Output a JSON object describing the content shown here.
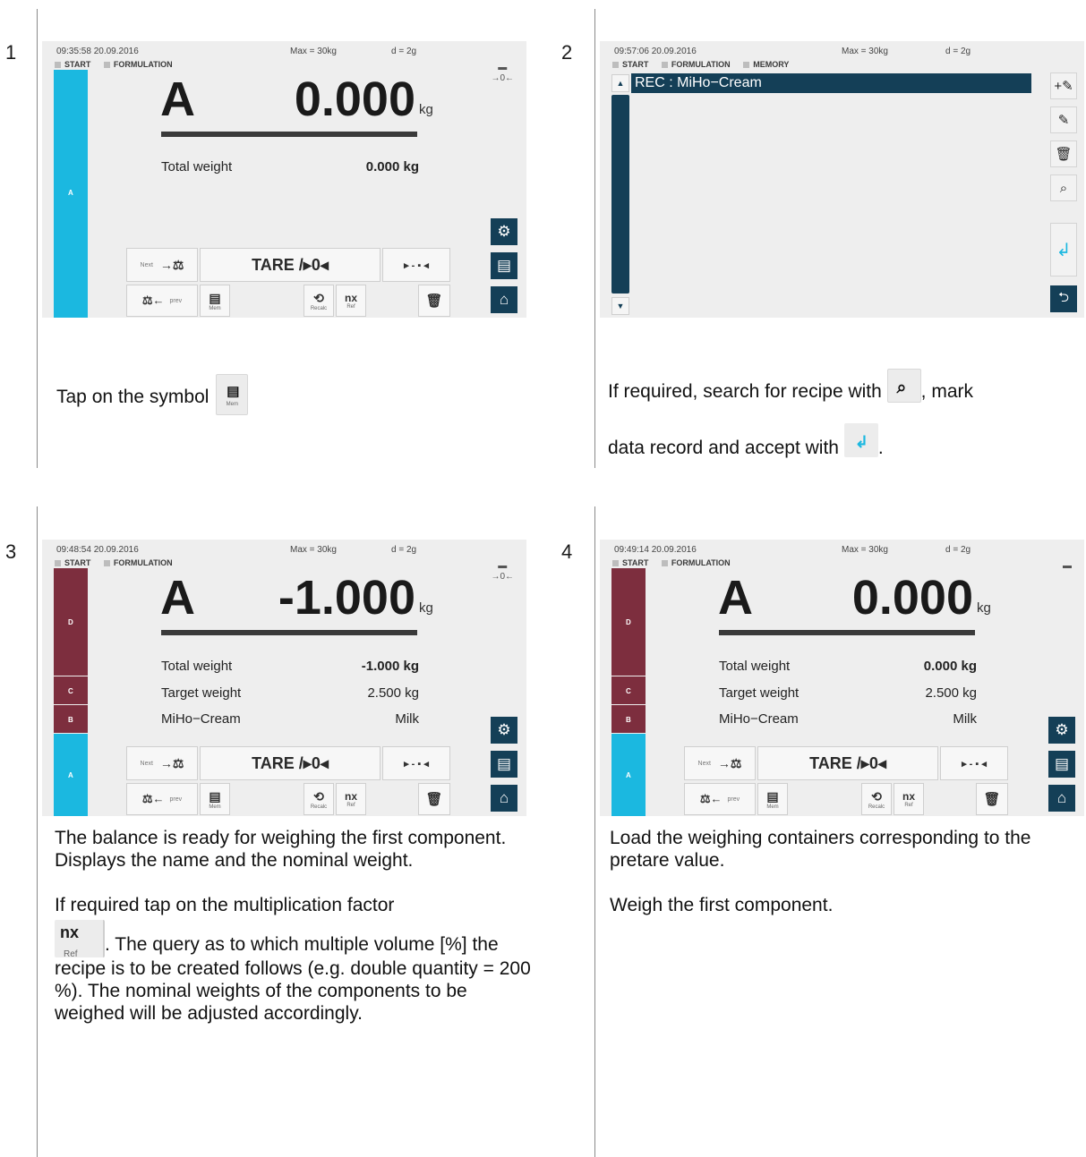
{
  "steps": [
    {
      "number": "1",
      "screen": {
        "time": "09:35:58 20.09.2016",
        "max": "Max = 30kg",
        "d": "d = 2g",
        "crumbs": [
          "START",
          "FORMULATION"
        ],
        "component": "A",
        "value": "0.000",
        "unit": "kg",
        "total_label": "Total weight",
        "total_value": "0.000 kg",
        "bar_label": "A",
        "next_label": "Next",
        "prev_label": "prev",
        "tare_label": "TARE /▸0◂",
        "mem_label": "Mem",
        "recalc_label": "Recalc",
        "ref_label": "Ref",
        "nx_label": "nx"
      },
      "caption": "Tap on the symbol"
    },
    {
      "number": "2",
      "screen": {
        "time": "09:57:06 20.09.2016",
        "max": "Max = 30kg",
        "d": "d = 2g",
        "crumbs": [
          "START",
          "FORMULATION",
          "MEMORY"
        ],
        "record": "REC : MiHo−Cream"
      },
      "caption_a": "If required, search for recipe with",
      "caption_b": ", mark",
      "caption_c": "data record and accept with",
      "caption_d": "."
    },
    {
      "number": "3",
      "screen": {
        "time": "09:48:54 20.09.2016",
        "max": "Max = 30kg",
        "d": "d = 2g",
        "crumbs": [
          "START",
          "FORMULATION"
        ],
        "component": "A",
        "value": "-1.000",
        "unit": "kg",
        "total_label": "Total weight",
        "total_value": "-1.000 kg",
        "target_label": "Target weight",
        "target_value": "2.500 kg",
        "name_label": "MiHo−Cream",
        "name_value": "Milk",
        "bars": [
          "D",
          "C",
          "B",
          "A"
        ],
        "next_label": "Next",
        "prev_label": "prev",
        "tare_label": "TARE /▸0◂",
        "mem_label": "Mem",
        "recalc_label": "Recalc",
        "ref_label": "Ref",
        "nx_label": "nx"
      },
      "caption_1": "The balance is ready for weighing the first component. Displays the name and the nominal weight.",
      "caption_2": "If required tap on the multiplication factor",
      "caption_3": ". The query as to which multiple volume [%] the recipe is to be created follows (e.g. double quantity = 200 %). The nominal weights of the components to be weighed will be adjusted accordingly."
    },
    {
      "number": "4",
      "screen": {
        "time": "09:49:14 20.09.2016",
        "max": "Max = 30kg",
        "d": "d = 2g",
        "crumbs": [
          "START",
          "FORMULATION"
        ],
        "component": "A",
        "value": "0.000",
        "unit": "kg",
        "total_label": "Total weight",
        "total_value": "0.000 kg",
        "target_label": "Target weight",
        "target_value": "2.500 kg",
        "name_label": "MiHo−Cream",
        "name_value": "Milk",
        "bars": [
          "D",
          "C",
          "B",
          "A"
        ],
        "next_label": "Next",
        "prev_label": "prev",
        "tare_label": "TARE /▸0◂",
        "mem_label": "Mem",
        "recalc_label": "Recalc",
        "ref_label": "Ref",
        "nx_label": "nx"
      },
      "caption_1": "Load the weighing containers corresponding to the pretare value.",
      "caption_2": "Weigh the first component."
    }
  ],
  "colors": {
    "blue_bar": "#1bb8e0",
    "maroon_bar": "#7d2e3e",
    "navy": "#143f57",
    "screen_bg": "#eeeeee"
  }
}
